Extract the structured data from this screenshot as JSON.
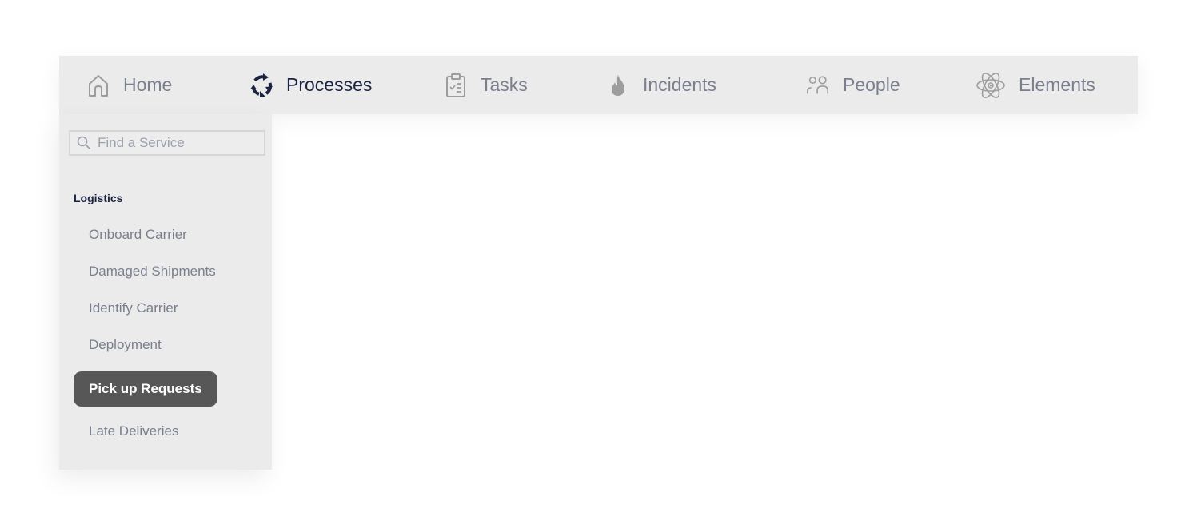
{
  "nav": {
    "items": [
      {
        "label": "Home",
        "icon": "home-icon",
        "active": false
      },
      {
        "label": "Processes",
        "icon": "cycle-arrows-icon",
        "active": true
      },
      {
        "label": "Tasks",
        "icon": "clipboard-check-icon",
        "active": false
      },
      {
        "label": "Incidents",
        "icon": "flame-icon",
        "active": false
      },
      {
        "label": "People",
        "icon": "people-icon",
        "active": false
      },
      {
        "label": "Elements",
        "icon": "atom-icon",
        "active": false
      }
    ]
  },
  "sidebar": {
    "search": {
      "placeholder": "Find a Service",
      "value": ""
    },
    "section_title": "Logistics",
    "items": [
      {
        "label": "Onboard Carrier"
      },
      {
        "label": "Damaged Shipments"
      },
      {
        "label": "Identify Carrier"
      },
      {
        "label": "Deployment"
      },
      {
        "label": "Pick up Requests",
        "active": true
      },
      {
        "label": "Late Deliveries"
      }
    ]
  },
  "colors": {
    "active_text": "#1b2340",
    "inactive_text": "#7a7f8e",
    "active_pill_bg": "#575757",
    "panel_bg": "#ebebeb"
  }
}
